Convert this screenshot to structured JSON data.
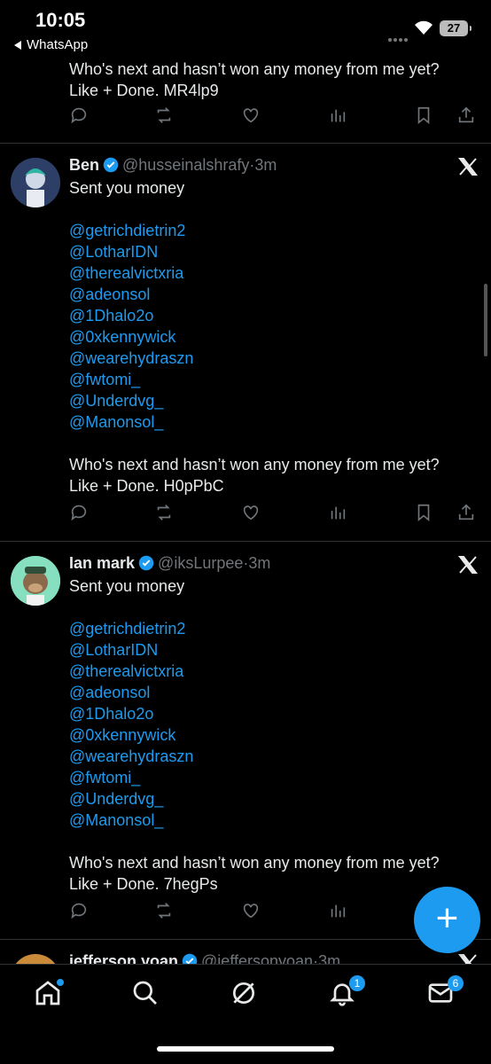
{
  "status": {
    "time": "10:05",
    "back_app": "WhatsApp",
    "battery": "27"
  },
  "top_tweet": {
    "line1": "Who's next and hasn’t won any money from me yet?",
    "line2": "Like + Done. MR4lp9"
  },
  "tweets": [
    {
      "name": "Ben",
      "handle": "@husseinalshrafy",
      "time": "3m",
      "line1": "Sent you money",
      "mentions": [
        "@getrichdietrin2",
        "@LotharIDN",
        "@therealvictxria",
        "@adeonsol",
        "@1Dhalo2o",
        "@0xkennywick",
        "@wearehydraszn",
        "@fwtomi_",
        "@Underdvg_",
        "@Manonsol_"
      ],
      "closing1": "Who's next and hasn’t won any money from me yet?",
      "closing2": "Like + Done. H0pPbC"
    },
    {
      "name": "Ian mark",
      "handle": "@iksLurpee",
      "time": "3m",
      "line1": "Sent you money",
      "mentions": [
        "@getrichdietrin2",
        "@LotharIDN",
        "@therealvictxria",
        "@adeonsol",
        "@1Dhalo2o",
        "@0xkennywick",
        "@wearehydraszn",
        "@fwtomi_",
        "@Underdvg_",
        "@Manonsol_"
      ],
      "closing1": "Who's next and hasn’t won any money from me yet?",
      "closing2": "Like + Done. 7hegPs"
    },
    {
      "name": "jefferson yoan",
      "handle": "@jeffersonyoan",
      "time": "3m"
    }
  ],
  "tabbar": {
    "icons": [
      "home-icon",
      "search-icon",
      "grok-icon",
      "notifications-icon",
      "messages-icon"
    ],
    "notifications_badge": "1",
    "messages_badge": "6"
  },
  "colors": {
    "accent": "#1d9bf0",
    "background": "#000000",
    "muted": "#71767b"
  }
}
